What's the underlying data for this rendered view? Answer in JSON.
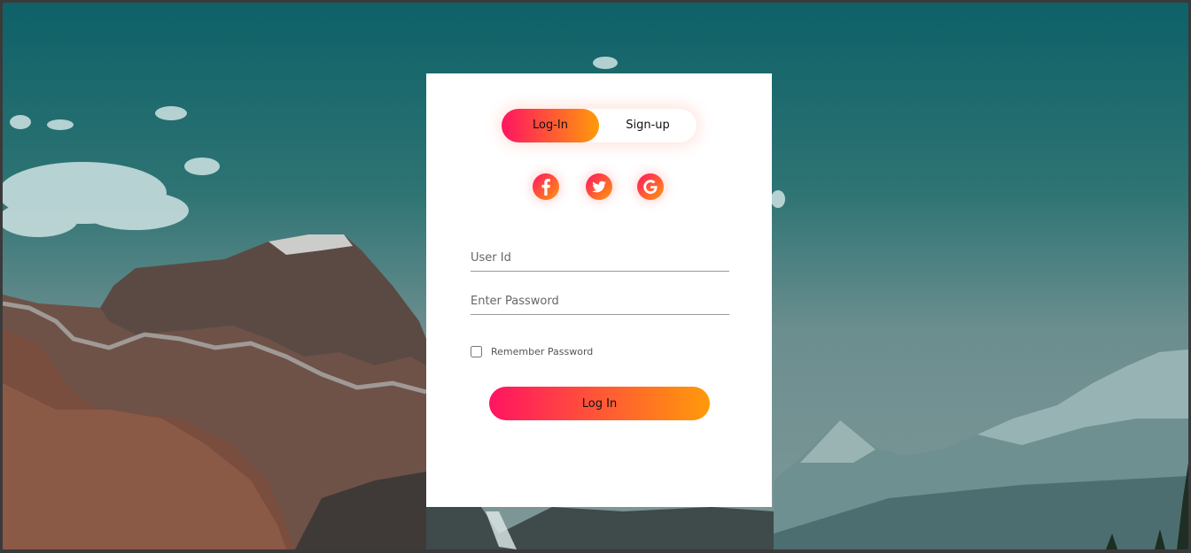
{
  "tabs": {
    "login_label": "Log-In",
    "signup_label": "Sign-up",
    "active": "login"
  },
  "social": [
    {
      "name": "facebook-icon"
    },
    {
      "name": "twitter-icon"
    },
    {
      "name": "google-icon"
    }
  ],
  "form": {
    "userid_placeholder": "User Id",
    "userid_value": "",
    "password_placeholder": "Enter Password",
    "password_value": "",
    "remember_label": "Remember Password",
    "remember_checked": false,
    "submit_label": "Log In"
  },
  "colors": {
    "gradient_start": "#ff1462",
    "gradient_end": "#ff9a0a",
    "card": "#ffffff"
  }
}
